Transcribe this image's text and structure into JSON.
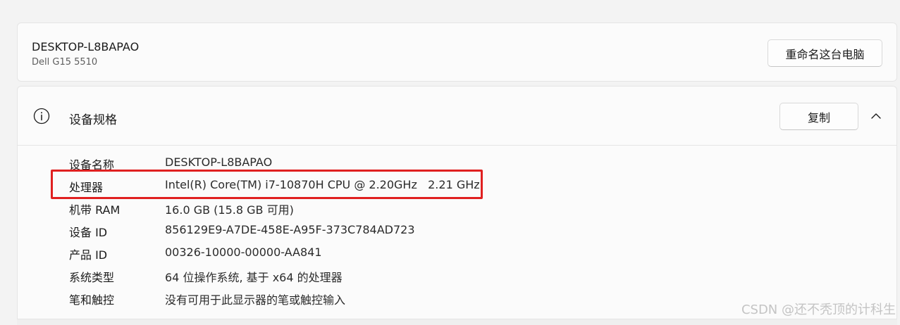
{
  "device": {
    "name": "DESKTOP-L8BAPAO",
    "model": "Dell G15 5510",
    "rename_label": "重命名这台电脑"
  },
  "specs": {
    "title": "设备规格",
    "copy_label": "复制",
    "rows": [
      {
        "label": "设备名称",
        "value": "DESKTOP-L8BAPAO"
      },
      {
        "label": "处理器",
        "value": "Intel(R) Core(TM) i7-10870H CPU @ 2.20GHz   2.21 GHz"
      },
      {
        "label": "机带 RAM",
        "value": "16.0 GB (15.8 GB 可用)"
      },
      {
        "label": "设备 ID",
        "value": "856129E9-A7DE-458E-A95F-373C784AD723"
      },
      {
        "label": "产品 ID",
        "value": "00326-10000-00000-AA841"
      },
      {
        "label": "系统类型",
        "value": "64 位操作系统, 基于 x64 的处理器"
      },
      {
        "label": "笔和触控",
        "value": "没有可用于此显示器的笔或触控输入"
      }
    ]
  },
  "icons": {
    "info": "info-icon",
    "chevron": "chevron-up-icon"
  },
  "highlight_color": "#e02020",
  "watermark": "CSDN @还不秃顶的计科生"
}
